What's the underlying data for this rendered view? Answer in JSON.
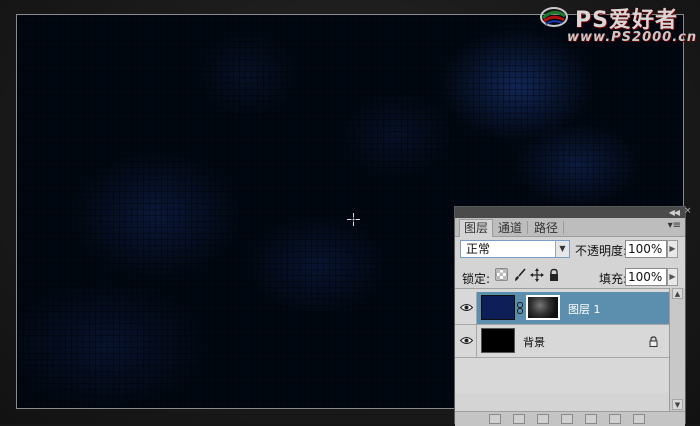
{
  "watermark": {
    "brand": "PS爱好者",
    "url": "www.PS2000.cn"
  },
  "colors": {
    "selected_layer": "#5b8fad",
    "layer1_fill": "#0e1f58",
    "background_fill": "#000000",
    "canvas_base": "#020812"
  },
  "layers_panel": {
    "tabs": [
      {
        "label": "图层",
        "active": true
      },
      {
        "label": "通道",
        "active": false
      },
      {
        "label": "路径",
        "active": false
      }
    ],
    "blend_mode": "正常",
    "opacity_label": "不透明度:",
    "opacity_value": "100%",
    "lock_label": "锁定:",
    "lock_icons": [
      "lock-transparent-icon",
      "lock-brush-icon",
      "lock-move-icon",
      "lock-all-icon"
    ],
    "fill_label": "填充:",
    "fill_value": "100%",
    "layers": [
      {
        "name": "图层 1",
        "visible": true,
        "selected": true,
        "has_mask": true
      },
      {
        "name": "背景",
        "visible": true,
        "selected": false,
        "locked": true
      }
    ]
  }
}
